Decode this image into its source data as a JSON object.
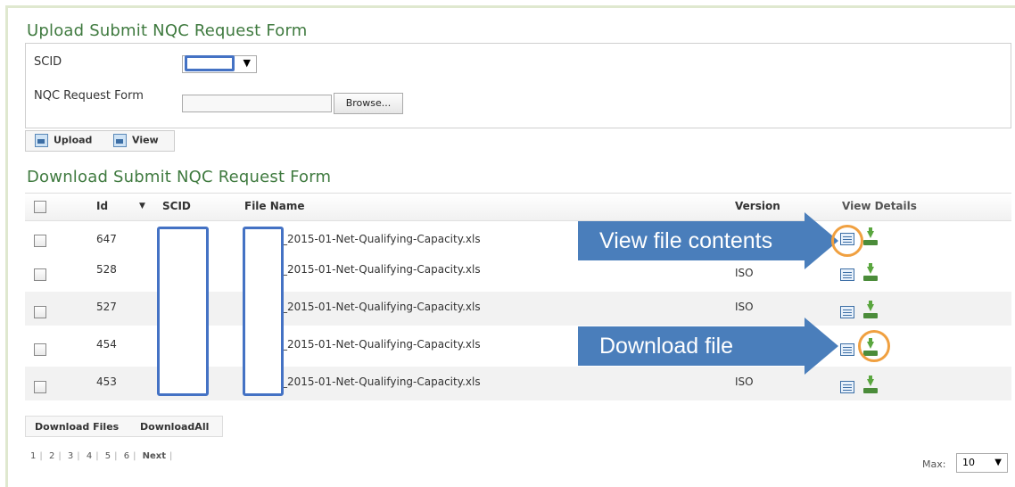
{
  "upload": {
    "title": "Upload Submit NQC Request Form",
    "scid_label": "SCID",
    "form_label": "NQC Request Form",
    "browse_label": "Browse...",
    "upload_label": "Upload",
    "view_label": "View"
  },
  "download": {
    "title": "Download Submit NQC Request Form",
    "columns": {
      "id": "Id",
      "sort_indicator": "▼",
      "scid": "SCID",
      "file_name": "File Name",
      "version": "Version",
      "view_details": "View Details"
    },
    "rows": [
      {
        "id": "647",
        "file_name": "_2015-01-Net-Qualifying-Capacity.xls",
        "version": ""
      },
      {
        "id": "528",
        "file_name": "_2015-01-Net-Qualifying-Capacity.xls",
        "version": "ISO"
      },
      {
        "id": "527",
        "file_name": "_2015-01-Net-Qualifying-Capacity.xls",
        "version": "ISO"
      },
      {
        "id": "454",
        "file_name": "_2015-01-Net-Qualifying-Capacity.xls",
        "version": ""
      },
      {
        "id": "453",
        "file_name": "_2015-01-Net-Qualifying-Capacity.xls",
        "version": "ISO"
      }
    ],
    "download_files_label": "Download Files",
    "download_all_label": "DownloadAll"
  },
  "pager": {
    "pages": [
      "1",
      "2",
      "3",
      "4",
      "5",
      "6"
    ],
    "next_label": "Next",
    "max_label": "Max:",
    "max_value": "10"
  },
  "callouts": {
    "view": "View file contents",
    "download": "Download file"
  },
  "colors": {
    "title_green": "#3f7a3f",
    "callout_blue": "#4a7ebb",
    "highlight_orange": "#f0a040",
    "redaction_border": "#4472c4"
  }
}
